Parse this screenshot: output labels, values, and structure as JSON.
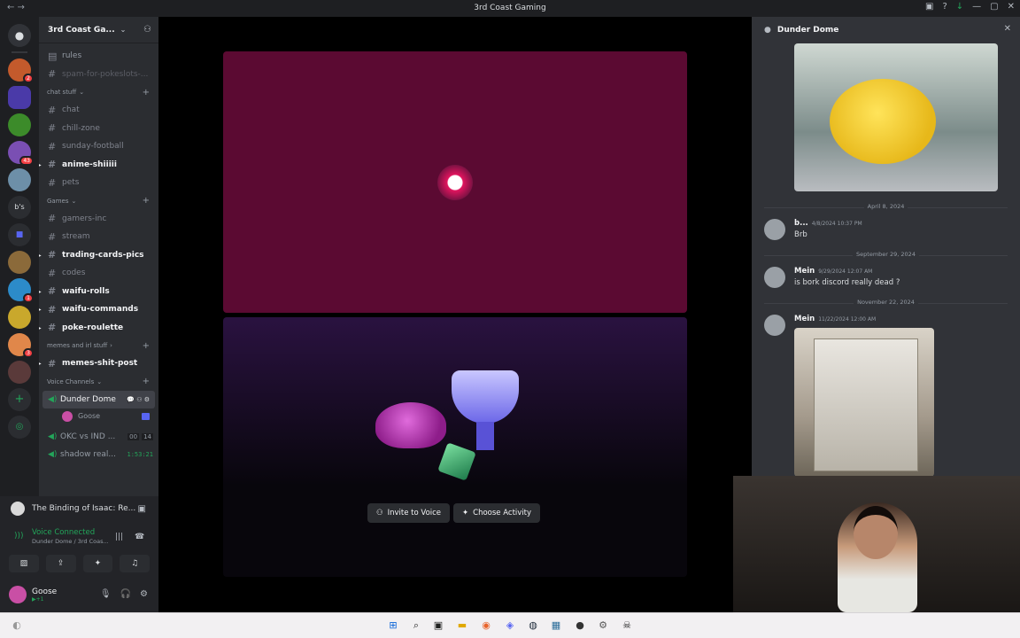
{
  "window": {
    "title": "3rd Coast Gaming",
    "accent": "#5865f2"
  },
  "server": {
    "name": "3rd Coast Ga..."
  },
  "channels_top": [
    {
      "name": "rules",
      "style": "normal"
    },
    {
      "name": "spam-for-pokeslots-...",
      "style": "muted"
    }
  ],
  "categories": {
    "chat": "chat stuff",
    "games": "Games",
    "memes": "memes and irl stuff",
    "voice": "Voice Channels"
  },
  "chat_channels": [
    {
      "name": "chat"
    },
    {
      "name": "chill-zone"
    },
    {
      "name": "sunday-football"
    },
    {
      "name": "anime-shiiiii",
      "unread": true
    },
    {
      "name": "pets"
    }
  ],
  "game_channels": [
    {
      "name": "gamers-inc"
    },
    {
      "name": "stream"
    },
    {
      "name": "trading-cards-pics",
      "unread": true
    },
    {
      "name": "codes"
    },
    {
      "name": "waifu-rolls",
      "unread": true
    },
    {
      "name": "waifu-commands",
      "unread": true
    },
    {
      "name": "poke-roulette",
      "unread": true
    }
  ],
  "meme_channels": [
    {
      "name": "memes-shit-post",
      "unread": true
    }
  ],
  "voice_channels": {
    "active": {
      "name": "Dunder Dome",
      "user": "Goose"
    },
    "okc": {
      "name": "OKC vs IND ...",
      "c1": "00",
      "c2": "14"
    },
    "shadow": {
      "name": "shadow real...",
      "timer": "1:53:21"
    }
  },
  "panel": {
    "game": "The Binding of Isaac: Re...",
    "voice_status": "Voice Connected",
    "voice_sub": "Dunder Dome / 3rd Coas...",
    "user_name": "Goose",
    "user_status": "▶+1"
  },
  "stage": {
    "invite_label": "Invite to Voice",
    "activity_label": "Choose Activity"
  },
  "chat": {
    "channel": "Dunder Dome",
    "dates": [
      "April 8, 2024",
      "September 29, 2024",
      "November 22, 2024"
    ],
    "messages": [
      {
        "author": "b...",
        "time": "4/8/2024 10:37 PM",
        "text": "Brb"
      },
      {
        "author": "Mein",
        "time": "9/29/2024 12:07 AM",
        "text": "is bork discord really dead ?"
      },
      {
        "author": "Mein",
        "time": "11/22/2024 12:00 AM",
        "text": ""
      }
    ]
  },
  "guild_badges": [
    "2",
    "43",
    "1",
    "3"
  ],
  "guild_text": "b's"
}
